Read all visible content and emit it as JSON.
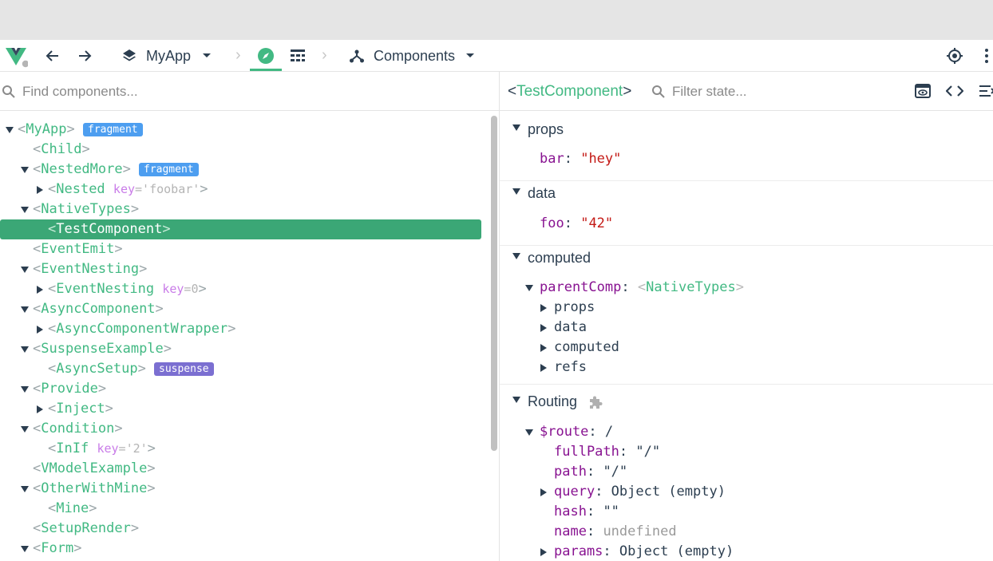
{
  "toolbar": {
    "app_name": "MyApp",
    "tab_components": "Components"
  },
  "tree_search": {
    "placeholder": "Find components..."
  },
  "tree": [
    {
      "name": "MyApp",
      "expanded": true,
      "badge": "fragment"
    },
    {
      "name": "Child"
    },
    {
      "name": "NestedMore",
      "expanded": true,
      "badge": "fragment"
    },
    {
      "name": "Nested",
      "expanded": false,
      "key_label": "key",
      "key_value": "'foobar'"
    },
    {
      "name": "NativeTypes",
      "expanded": true
    },
    {
      "name": "TestComponent",
      "selected": true
    },
    {
      "name": "EventEmit"
    },
    {
      "name": "EventNesting",
      "expanded": true
    },
    {
      "name": "EventNesting",
      "expanded": false,
      "key_label": "key",
      "key_value": "0"
    },
    {
      "name": "AsyncComponent",
      "expanded": true
    },
    {
      "name": "AsyncComponentWrapper",
      "expanded": false
    },
    {
      "name": "SuspenseExample",
      "expanded": true
    },
    {
      "name": "AsyncSetup",
      "badge": "suspense"
    },
    {
      "name": "Provide",
      "expanded": true
    },
    {
      "name": "Inject",
      "expanded": false
    },
    {
      "name": "Condition",
      "expanded": true
    },
    {
      "name": "InIf",
      "key_label": "key",
      "key_value": "'2'"
    },
    {
      "name": "VModelExample"
    },
    {
      "name": "OtherWithMine",
      "expanded": true
    },
    {
      "name": "Mine"
    },
    {
      "name": "SetupRender"
    },
    {
      "name": "Form",
      "expanded": true
    }
  ],
  "inspector": {
    "component_name": "TestComponent",
    "filter_placeholder": "Filter state...",
    "props": {
      "title": "props",
      "items": [
        {
          "key": "bar",
          "value": "\"hey\""
        }
      ]
    },
    "data": {
      "title": "data",
      "items": [
        {
          "key": "foo",
          "value": "\"42\""
        }
      ]
    },
    "computed": {
      "title": "computed",
      "parent_key": "parentComp",
      "parent_value": "NativeTypes",
      "children": [
        "props",
        "data",
        "computed",
        "refs"
      ]
    },
    "routing": {
      "title": "Routing",
      "route_key": "$route",
      "route_value": "/",
      "fields": {
        "fullPath_key": "fullPath",
        "fullPath_value": "\"/\"",
        "path_key": "path",
        "path_value": "\"/\"",
        "query_key": "query",
        "query_value": "Object (empty)",
        "hash_key": "hash",
        "hash_value": "\"\"",
        "name_key": "name",
        "name_value": "undefined",
        "params_key": "params",
        "params_value": "Object (empty)"
      }
    }
  },
  "colors": {
    "accent": "#42b983",
    "selected_row": "#3ba776",
    "fragment_badge": "#4d9ef0",
    "suspense_badge": "#7b6fd1",
    "key_color": "#881391",
    "string_color": "#c41a16"
  }
}
